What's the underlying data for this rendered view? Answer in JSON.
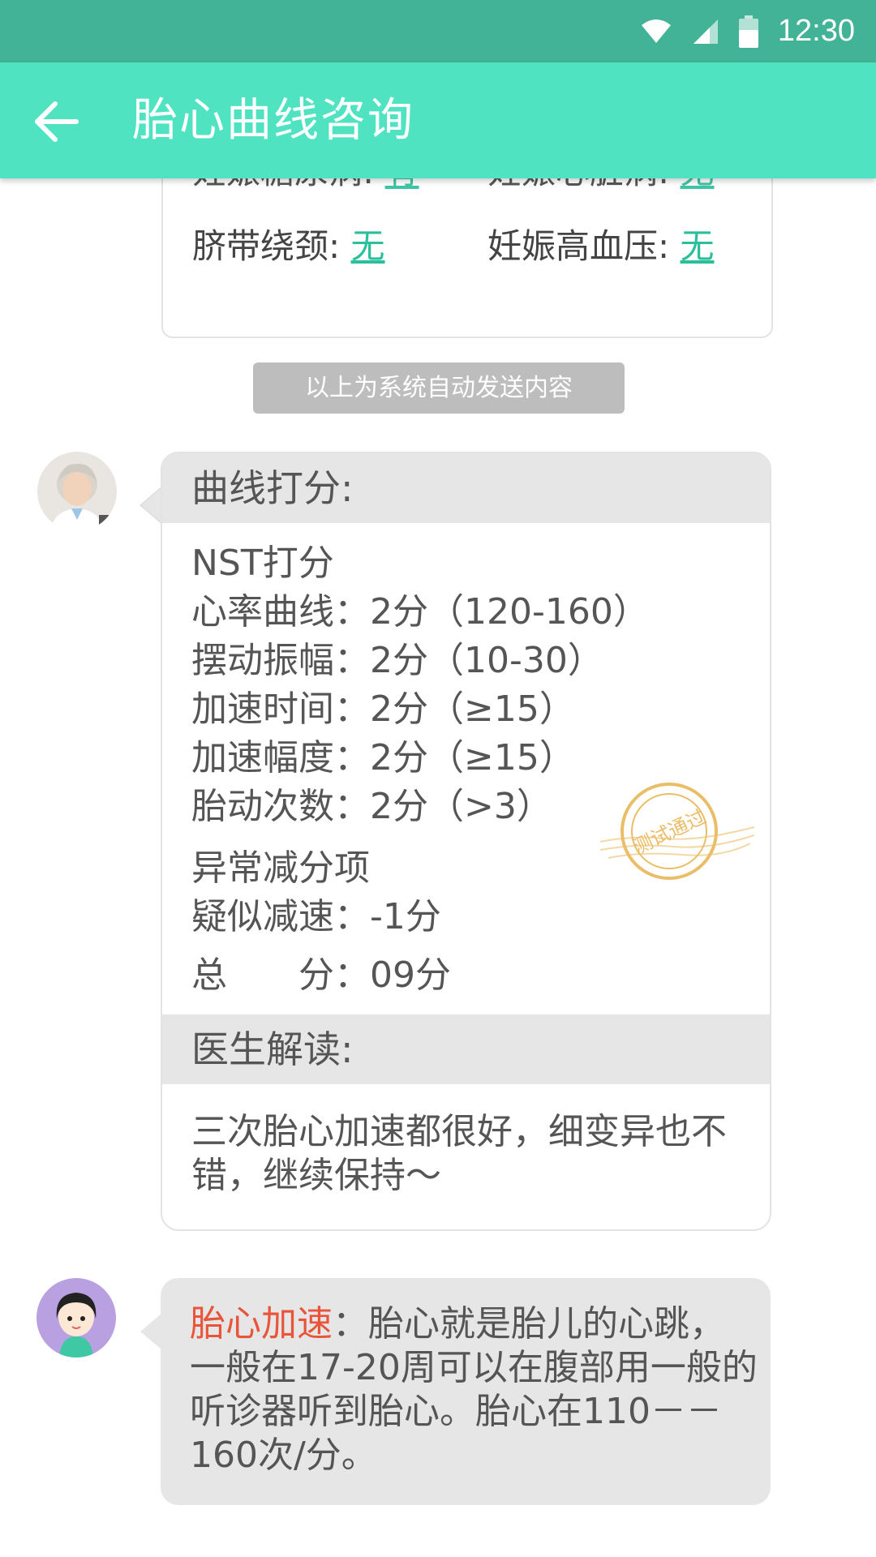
{
  "status_bar": {
    "time": "12:30"
  },
  "app_bar": {
    "title": "胎心曲线咨询",
    "back_icon": "back-arrow-icon"
  },
  "info_card": {
    "partial_left_label": "妊娠糖尿病:",
    "partial_left_value": "有",
    "partial_right_label": "妊娠心脏病:",
    "partial_right_value": "无",
    "cord_label": "脐带绕颈:",
    "cord_value": "无",
    "hypertension_label": "妊娠高血压:",
    "hypertension_value": "无"
  },
  "system_notice": "以上为系统自动发送内容",
  "score_card": {
    "header": "曲线打分:",
    "nst_title": "NST打分",
    "items": [
      "心率曲线：2分（120-160）",
      "摆动振幅：2分（10-30）",
      "加速时间：2分（≥15）",
      "加速幅度：2分（≥15）",
      "胎动次数：2分（>3）"
    ],
    "abnormal_title": "异常减分项",
    "abnormal_item": "疑似减速：-1分",
    "total_label": "总　　分：",
    "total_value": "09分",
    "stamp_text": "测试通过",
    "interpretation_header": "医生解读:",
    "interpretation_text": "三次胎心加速都很好，细变异也不错，继续保持～"
  },
  "tip_bubble": {
    "highlight": "胎心加速",
    "text": "：胎心就是胎儿的心跳，一般在17-20周可以在腹部用一般的听诊器听到胎心。胎心在110－－160次/分。"
  },
  "colors": {
    "status_bar": "#43b398",
    "app_bar": "#50e3c2",
    "link": "#2bbf9c",
    "highlight": "#e8553b",
    "bubble_gray": "#e6e6e6"
  }
}
